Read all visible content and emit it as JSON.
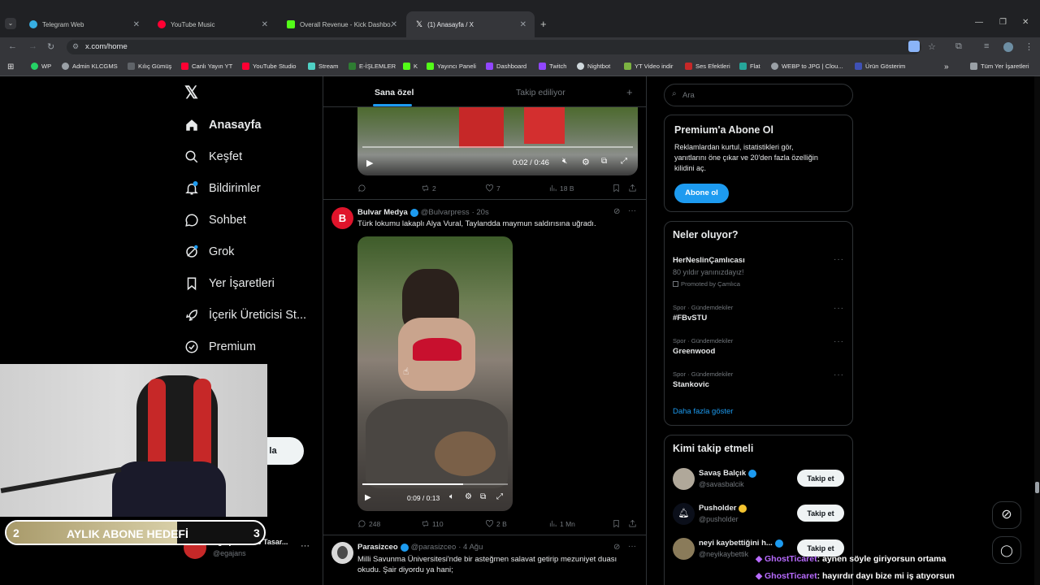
{
  "browser": {
    "tabs": [
      {
        "title": "Telegram Web",
        "color": "#37aee2"
      },
      {
        "title": "YouTube Music",
        "color": "#ff0033"
      },
      {
        "title": "Overall Revenue - Kick Dashbo...",
        "color": "#53fc18"
      },
      {
        "title": "(1) Anasayfa / X",
        "color": "#ffffff"
      }
    ],
    "url": "x.com/home",
    "bookmarks": [
      "WP",
      "Admin KLCGMS",
      "Kılıç Gümüş",
      "Canlı Yayın YT",
      "YouTube Studio",
      "Stream",
      "E-İŞLEMLER",
      "K",
      "Yayıncı Paneli",
      "Dashboard",
      "Twitch",
      "Nightbot",
      "YT Video indir",
      "Ses Efektleri",
      "Flat",
      "WEBP to JPG | Clou...",
      "Ürün Gösterim"
    ],
    "all_bookmarks": "Tüm Yer İşaretleri"
  },
  "nav": {
    "items": [
      "Anasayfa",
      "Keşfet",
      "Bildirimler",
      "Sohbet",
      "Grok",
      "Yer İşaretleri",
      "İçerik Üreticisi St...",
      "Premium"
    ],
    "post_button_partial": "la",
    "account": {
      "name": "Eg Ajans Web Tasar...",
      "handle": "@egajans"
    }
  },
  "feed": {
    "tabs": {
      "for_you": "Sana özel",
      "following": "Takip ediliyor"
    },
    "post1": {
      "video_time": "0:02 / 0:46",
      "stats": {
        "reposts": "2",
        "likes": "7",
        "views": "18 B"
      }
    },
    "post2": {
      "author": "Bulvar Medya",
      "handle": "@Bulvarpress",
      "time": "· 20s",
      "text": "Türk lokumu lakaplı Alya Vural, Taylandda maymun saldırısına uğradı.",
      "video_time": "0:09 / 0:13",
      "stats": {
        "replies": "248",
        "reposts": "110",
        "likes": "2 B",
        "views": "1 Mn"
      }
    },
    "post3": {
      "author": "Parasizceo",
      "handle": "@parasizceo",
      "time": "· 4 Ağu",
      "text_line1": "Milli Savunma Üniversitesi'nde bir asteğmen salavat getirip mezuniyet duası",
      "text_line2": "okudu. Şair diyordu ya hani;"
    }
  },
  "sidebar": {
    "search_placeholder": "Ara",
    "premium": {
      "title": "Premium'a Abone Ol",
      "line1": "Reklamlardan kurtul, istatistikleri gör,",
      "line2": "yanıtlarını öne çıkar ve 20'den fazla özelliğin",
      "line3": "kilidini aç.",
      "button": "Abone ol"
    },
    "trends": {
      "title": "Neler oluyor?",
      "promoted": {
        "name": "HerNeslinÇamlıcası",
        "desc": "80 yıldır yanınızdayız!",
        "by": "Promoted by Çamlıca"
      },
      "items": [
        {
          "meta": "Spor · Gündemdekiler",
          "name": "#FBvSTU"
        },
        {
          "meta": "Spor · Gündemdekiler",
          "name": "Greenwood"
        },
        {
          "meta": "Spor · Gündemdekiler",
          "name": "Stankovic"
        }
      ],
      "show_more": "Daha fazla göster"
    },
    "who_to_follow": {
      "title": "Kimi takip etmeli",
      "follow_label": "Takip et",
      "accounts": [
        {
          "name": "Savaş Balçık",
          "handle": "@savasbalcik"
        },
        {
          "name": "Pusholder",
          "handle": "@pusholder"
        },
        {
          "name": "neyi kaybettiğini h...",
          "handle": "@neyikaybettik"
        }
      ]
    }
  },
  "overlay": {
    "goal_left": "2",
    "goal_text": "AYLIK ABONE HEDEFİ",
    "goal_right": "3",
    "chat": [
      {
        "user": "GhostTicaret",
        "msg": ": aynen söyle giriyorsun ortama"
      },
      {
        "user": "GhostTicaret",
        "msg": ": hayırdır dayı bize mi iş atıyorsun"
      }
    ]
  }
}
